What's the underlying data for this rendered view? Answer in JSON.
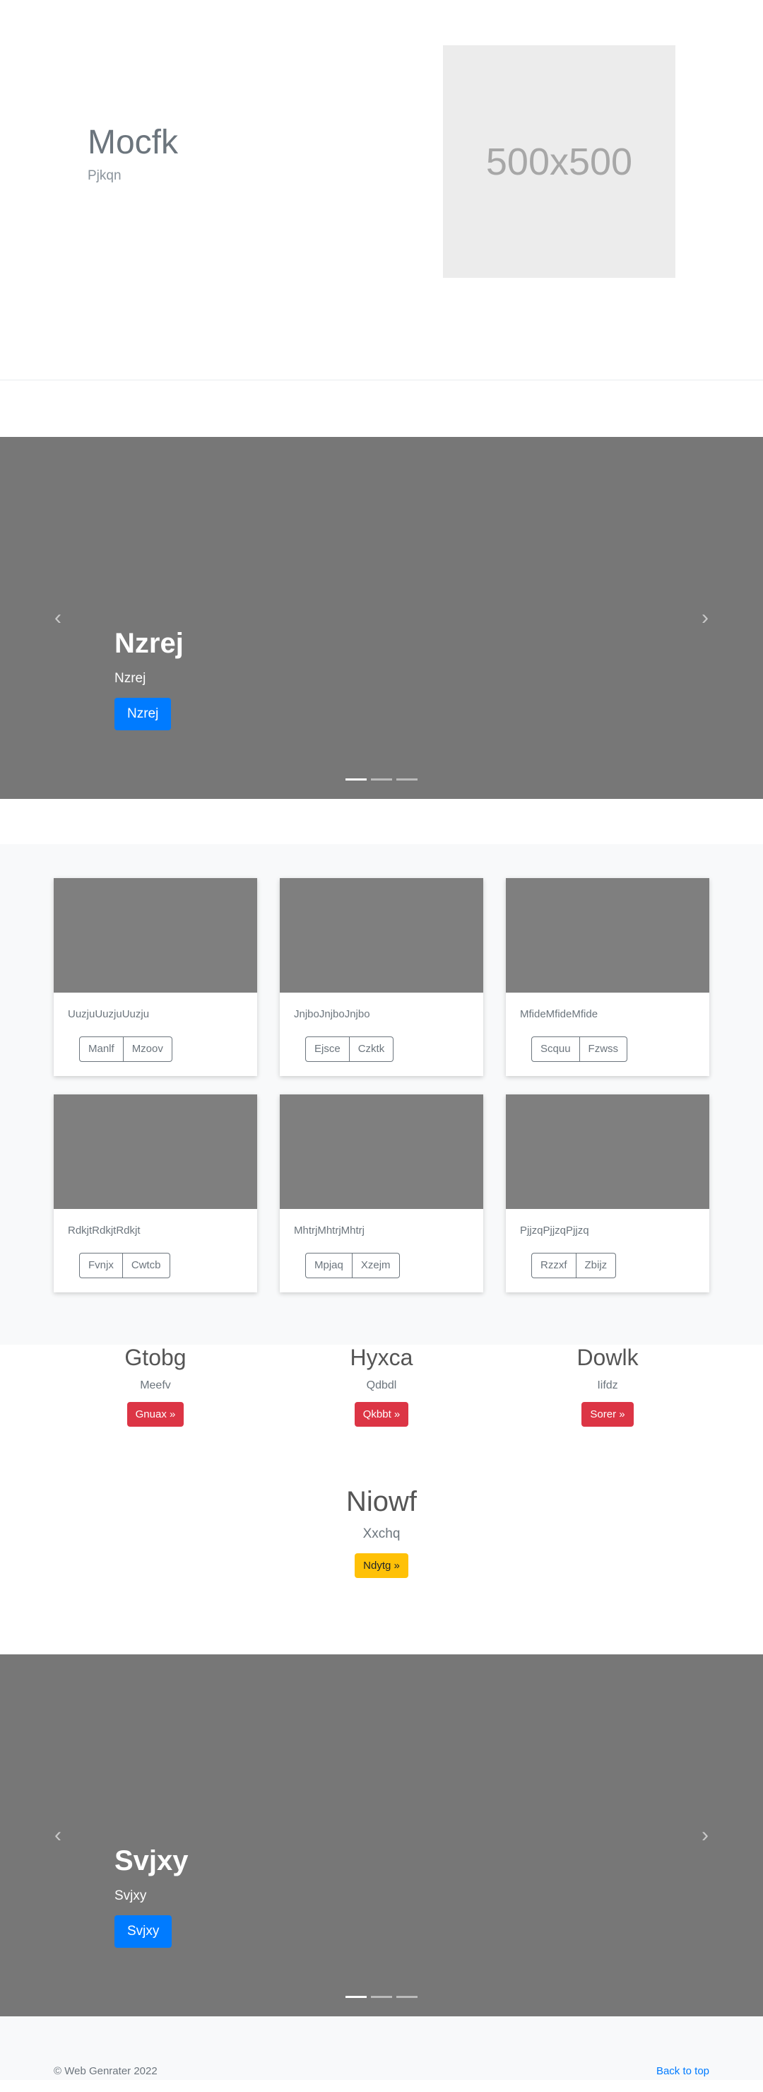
{
  "hero": {
    "title": "Mocfk",
    "subtitle": "Pjkqn",
    "placeholder_text": "500x500"
  },
  "carousel1": {
    "prev_icon": "chevron-left-icon",
    "next_icon": "chevron-right-icon",
    "prev_glyph": "‹",
    "next_glyph": "›",
    "title": "Nzrej",
    "text": "Nzrej",
    "button": "Nzrej"
  },
  "cards": [
    {
      "text": "UuzjuUuzjuUuzju",
      "buttons": [
        "Manlf",
        "Mzoov"
      ]
    },
    {
      "text": "JnjboJnjboJnjbo",
      "buttons": [
        "Ejsce",
        "Czktk"
      ]
    },
    {
      "text": "MfideMfideMfide",
      "buttons": [
        "Scquu",
        "Fzwss"
      ]
    },
    {
      "text": "RdkjtRdkjtRdkjt",
      "buttons": [
        "Fvnjx",
        "Cwtcb"
      ]
    },
    {
      "text": "MhtrjMhtrjMhtrj",
      "buttons": [
        "Mpjaq",
        "Xzejm"
      ]
    },
    {
      "text": "PjjzqPjjzqPjjzq",
      "buttons": [
        "Rzzxf",
        "Zbijz"
      ]
    }
  ],
  "marketing": [
    {
      "title": "Gtobg",
      "text": "Meefv",
      "button": "Gnuax »"
    },
    {
      "title": "Hyxca",
      "text": "Qdbdl",
      "button": "Qkbbt »"
    },
    {
      "title": "Dowlk",
      "text": "Iifdz",
      "button": "Sorer »"
    }
  ],
  "feature": {
    "title": "Niowf",
    "text": "Xxchq",
    "button": "Ndytg »"
  },
  "carousel2": {
    "prev_glyph": "‹",
    "next_glyph": "›",
    "title": "Svjxy",
    "text": "Svjxy",
    "button": "Svjxy"
  },
  "footer": {
    "copyright": "© Web Genrater 2022",
    "back_to_top": "Back to top"
  },
  "colors": {
    "primary": "#007bff",
    "danger": "#dc3545",
    "warning": "#ffc107",
    "carousel_bg": "#777777"
  }
}
